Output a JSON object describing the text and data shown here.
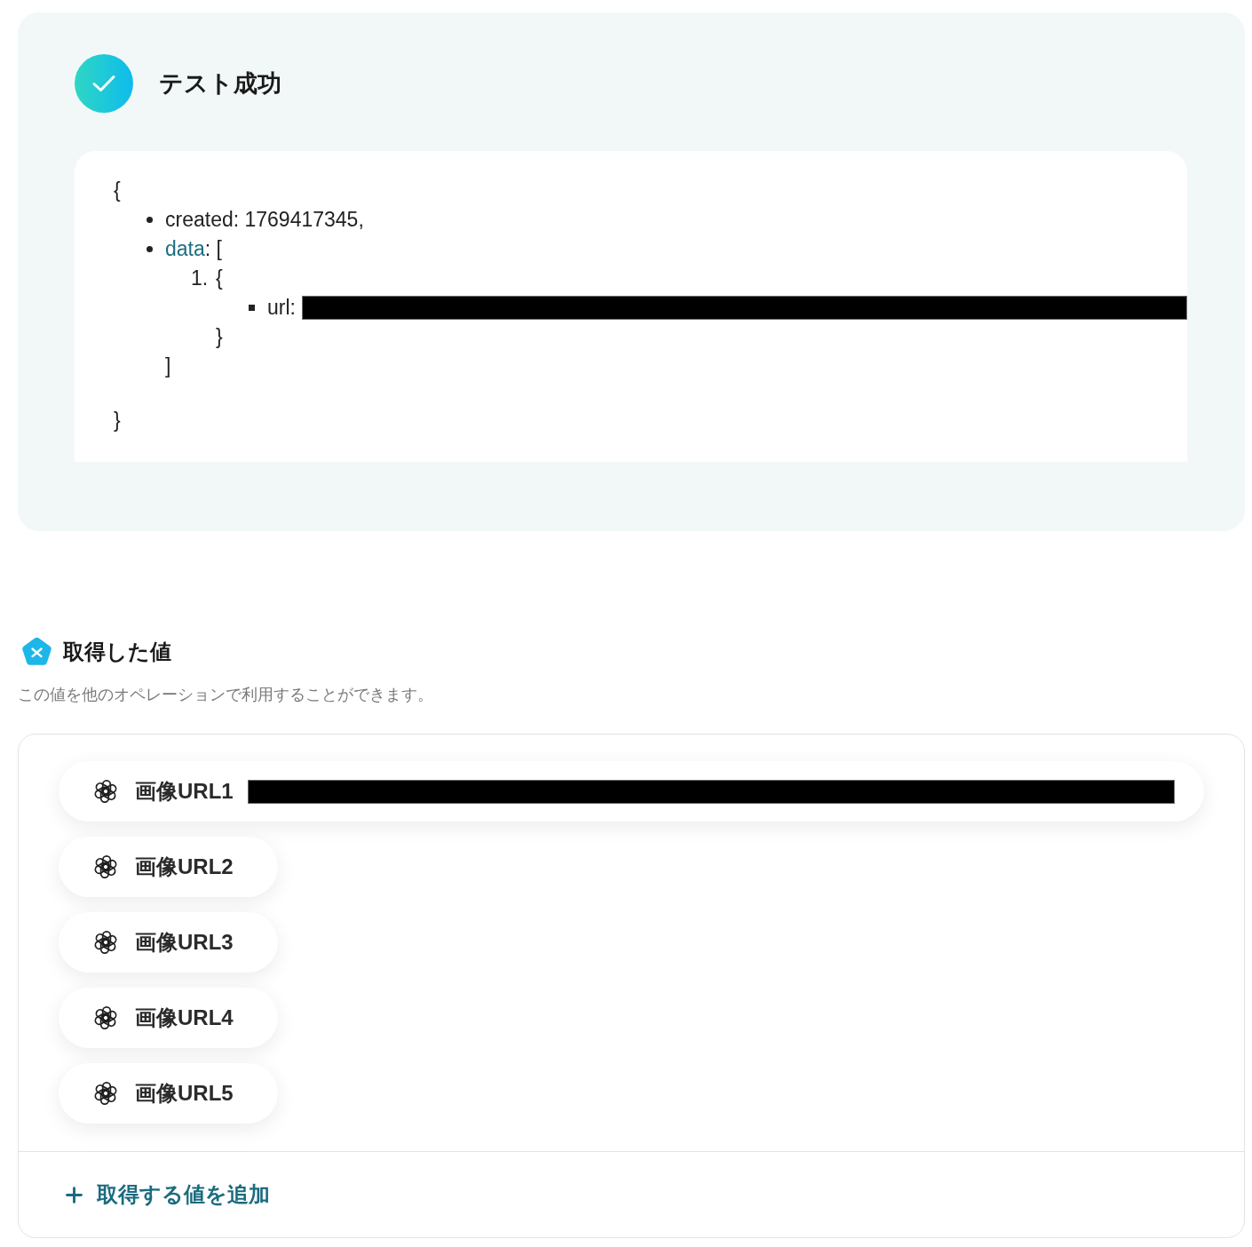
{
  "result": {
    "succeeded": true,
    "title": "テスト成功",
    "response": {
      "open": "{",
      "close": "}",
      "items": [
        {
          "kind": "field",
          "key": "created",
          "value": ": 1769417345,"
        },
        {
          "kind": "array",
          "key": "data",
          "value": ": [",
          "close": "]",
          "children": [
            {
              "kind": "object",
              "number": "1.",
              "open": "{",
              "close": "}",
              "children": [
                {
                  "kind": "field",
                  "key": "url",
                  "value": ":",
                  "redacted": true
                }
              ]
            }
          ]
        }
      ]
    }
  },
  "values_section": {
    "title": "取得した値",
    "description": "この値を他のオペレーションで利用することができます。",
    "values": [
      {
        "label": "画像URL1",
        "redacted": true
      },
      {
        "label": "画像URL2",
        "redacted": false
      },
      {
        "label": "画像URL3",
        "redacted": false
      },
      {
        "label": "画像URL4",
        "redacted": false
      },
      {
        "label": "画像URL5",
        "redacted": false
      }
    ],
    "add_button": "取得する値を追加"
  }
}
